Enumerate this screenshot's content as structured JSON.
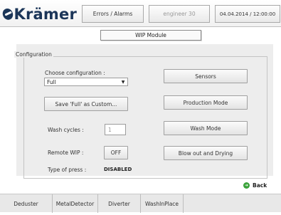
{
  "header": {
    "logo_text": "Krämer",
    "errors_label": "Errors / Alarms",
    "user_label": "engineer 30",
    "datetime": "04.04.2014 / 12:00:00"
  },
  "module_title": "WIP Module",
  "configuration": {
    "legend": "Configuration",
    "choose_label": "Choose configuration :",
    "selected_value": "Full",
    "save_button": "Save 'Full' as Custom...",
    "wash_cycles_label": "Wash cycles :",
    "wash_cycles_value": "1",
    "remote_wip_label": "Remote WIP :",
    "remote_wip_button": "OFF",
    "type_of_press_label": "Type of press :",
    "type_of_press_value": "DISABLED"
  },
  "actions": {
    "sensors": "Sensors",
    "production_mode": "Production Mode",
    "wash_mode": "Wash Mode",
    "blow_out": "Blow out and Drying"
  },
  "back_label": "Back",
  "bottom_tabs": [
    "Deduster",
    "MetalDetector",
    "Diverter",
    "WashInPlace"
  ],
  "colors": {
    "brand": "#1b3558",
    "panel": "#ededed",
    "back_icon": "#3aa23a"
  }
}
